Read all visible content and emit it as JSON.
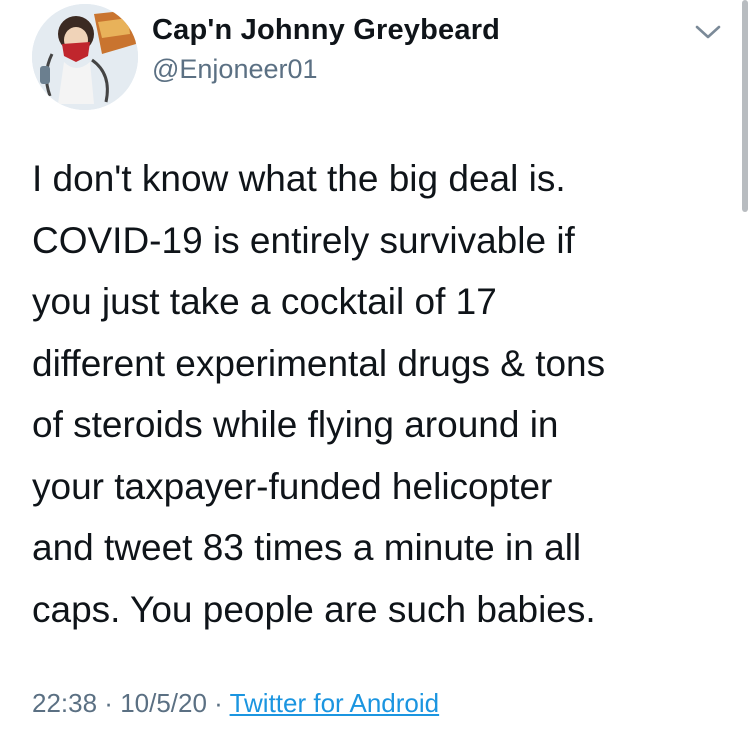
{
  "author": {
    "display_name": "Cap'n Johnny Greybeard",
    "handle": "@Enjoneer01",
    "avatar_icon": "profile-avatar"
  },
  "header": {
    "menu_icon": "chevron-down-icon"
  },
  "tweet": {
    "lines": [
      "I don't know what the big deal is.",
      "COVID-19 is entirely survivable if",
      "you just take a cocktail of 17",
      "different experimental drugs & tons",
      "of steroids while flying around in",
      "your taxpayer-funded helicopter",
      "and tweet 83 times a minute in all",
      "caps. You people are such babies."
    ]
  },
  "meta": {
    "time": "22:38",
    "separator": " · ",
    "date": "10/5/20",
    "source": "Twitter for Android"
  },
  "colors": {
    "text": "#0f1419",
    "secondary": "#5b7083",
    "link": "#1b95e0"
  }
}
